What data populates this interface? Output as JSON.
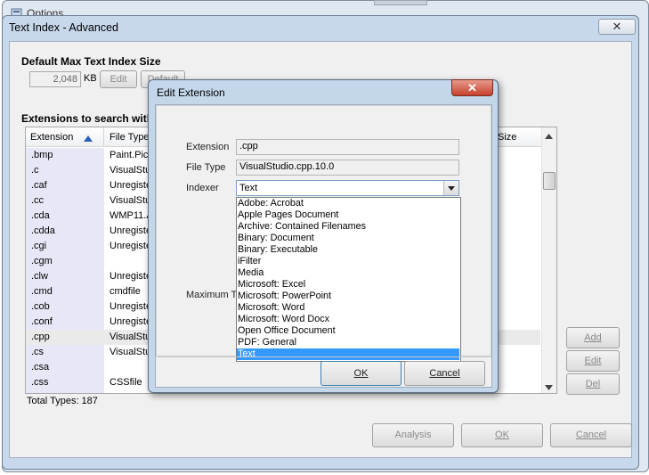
{
  "options_window": {
    "title": "Options"
  },
  "text_index": {
    "title": "Text Index - Advanced",
    "close_glyph": "✕",
    "max_size_heading": "Default Max Text Index Size",
    "max_size_value": "2,048",
    "max_size_unit": "KB",
    "edit_button": "Edit",
    "default_button": "Default",
    "extensions_heading": "Extensions to search with",
    "columns": {
      "extension": "Extension",
      "file_type": "File Type",
      "size": "Size"
    },
    "rows": [
      {
        "ext": ".bmp",
        "type": "Paint.Pict"
      },
      {
        "ext": ".c",
        "type": "VisualStu"
      },
      {
        "ext": ".caf",
        "type": "Unregiste"
      },
      {
        "ext": ".cc",
        "type": "VisualStu"
      },
      {
        "ext": ".cda",
        "type": "WMP11.A"
      },
      {
        "ext": ".cdda",
        "type": "Unregiste"
      },
      {
        "ext": ".cgi",
        "type": "Unregiste"
      },
      {
        "ext": ".cgm",
        "type": ""
      },
      {
        "ext": ".clw",
        "type": "Unregiste"
      },
      {
        "ext": ".cmd",
        "type": "cmdfile"
      },
      {
        "ext": ".cob",
        "type": "Unregiste"
      },
      {
        "ext": ".conf",
        "type": "Unregiste"
      },
      {
        "ext": ".cpp",
        "type": "VisualStu"
      },
      {
        "ext": ".cs",
        "type": "VisualStu"
      },
      {
        "ext": ".csa",
        "type": ""
      },
      {
        "ext": ".css",
        "type": "CSSfile"
      }
    ],
    "total_types": "Total Types: 187",
    "add_button": "Add",
    "edit_row_button": "Edit",
    "del_button": "Del",
    "analysis_button": "Analysis",
    "ok_button": "OK",
    "cancel_button": "Cancel"
  },
  "edit_extension": {
    "title": "Edit Extension",
    "close_glyph": "✕",
    "extension_label": "Extension",
    "extension_value": ".cpp",
    "file_type_label": "File Type",
    "file_type_value": "VisualStudio.cpp.10.0",
    "indexer_label": "Indexer",
    "indexer_value": "Text",
    "max_label": "Maximum Te",
    "indexer_options": [
      "Adobe: Acrobat",
      "Apple Pages Document",
      "Archive: Contained Filenames",
      "Binary: Document",
      "Binary: Executable",
      "iFilter",
      "Media",
      "Microsoft: Excel",
      "Microsoft: PowerPoint",
      "Microsoft: Word",
      "Microsoft: Word Docx",
      "Open Office Document",
      "PDF: General",
      "Text"
    ],
    "ok_button": "OK",
    "cancel_button": "Cancel"
  },
  "colors": {
    "selection": "#3399ff",
    "close_red": "#c5422e",
    "window_frame": "#c7d8ec"
  }
}
